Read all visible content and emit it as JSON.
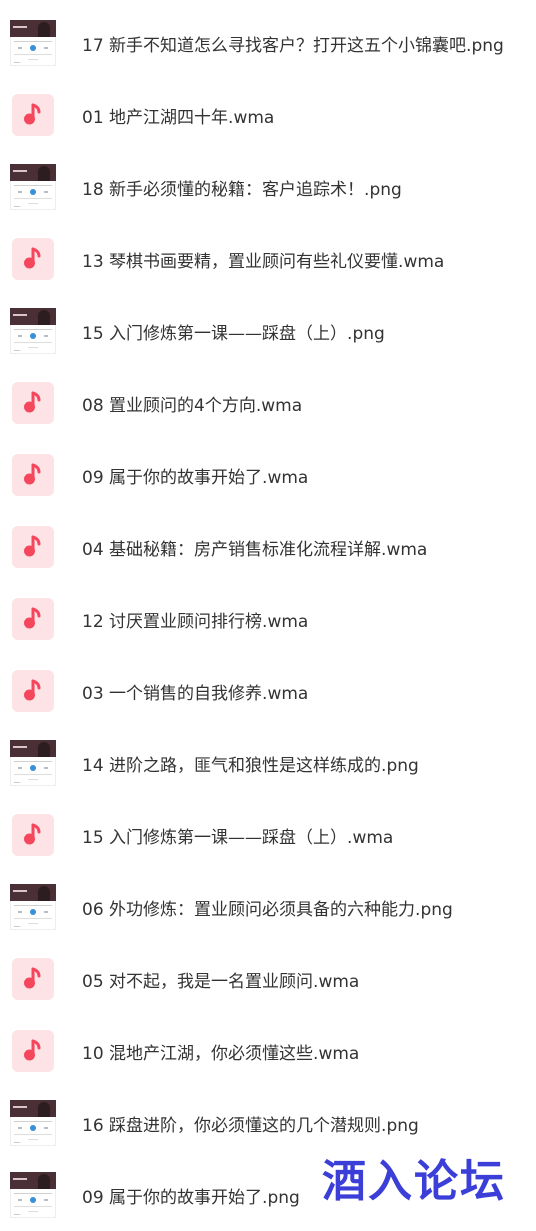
{
  "files": [
    {
      "name": "17 新手不知道怎么寻找客户？打开这五个小锦囊吧.png",
      "type": "png"
    },
    {
      "name": "01 地产江湖四十年.wma",
      "type": "wma"
    },
    {
      "name": "18 新手必须懂的秘籍：客户追踪术！.png",
      "type": "png"
    },
    {
      "name": "13 琴棋书画要精，置业顾问有些礼仪要懂.wma",
      "type": "wma"
    },
    {
      "name": "15 入门修炼第一课——踩盘（上）.png",
      "type": "png"
    },
    {
      "name": "08 置业顾问的4个方向.wma",
      "type": "wma"
    },
    {
      "name": "09 属于你的故事开始了.wma",
      "type": "wma"
    },
    {
      "name": "04 基础秘籍：房产销售标准化流程详解.wma",
      "type": "wma"
    },
    {
      "name": "12 讨厌置业顾问排行榜.wma",
      "type": "wma"
    },
    {
      "name": "03 一个销售的自我修养.wma",
      "type": "wma"
    },
    {
      "name": "14 进阶之路，匪气和狼性是这样练成的.png",
      "type": "png"
    },
    {
      "name": "15 入门修炼第一课——踩盘（上）.wma",
      "type": "wma"
    },
    {
      "name": "06 外功修炼：置业顾问必须具备的六种能力.png",
      "type": "png"
    },
    {
      "name": "05 对不起，我是一名置业顾问.wma",
      "type": "wma"
    },
    {
      "name": "10 混地产江湖，你必须懂这些.wma",
      "type": "wma"
    },
    {
      "name": "16 踩盘进阶，你必须懂这的几个潜规则.png",
      "type": "png"
    },
    {
      "name": "09 属于你的故事开始了.png",
      "type": "png"
    }
  ],
  "icons": {
    "wma": "music-note-icon",
    "png": "image-thumbnail"
  },
  "colors": {
    "audio_icon_bg": "#fde3e6",
    "audio_icon_fg": "#f5475b",
    "text": "#333333",
    "watermark": "#3b3fd8"
  },
  "watermark": "酒入论坛"
}
